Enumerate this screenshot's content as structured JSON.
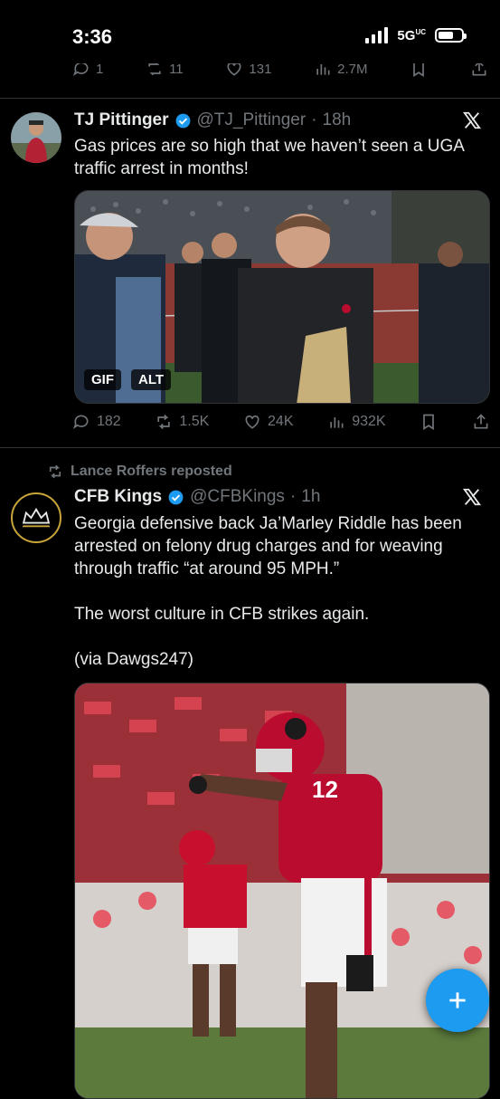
{
  "status_bar": {
    "time": "3:36",
    "network": "5G",
    "network_suffix": "UC"
  },
  "previous_tweet": {
    "replies": "1",
    "reposts": "11",
    "likes": "131",
    "views": "2.7M"
  },
  "tweet1": {
    "name": "TJ Pittinger",
    "handle": "@TJ_Pittinger",
    "separator": "·",
    "time": "18h",
    "text": "Gas prices are so high that we haven’t seen a UGA traffic arrest in months!",
    "media_badges": [
      "GIF",
      "ALT"
    ],
    "replies": "182",
    "reposts": "1.5K",
    "likes": "24K",
    "views": "932K"
  },
  "repost_context": {
    "label": "Lance Roffers reposted"
  },
  "tweet2": {
    "name": "CFB Kings",
    "handle": "@CFBKings",
    "separator": "·",
    "time": "1h",
    "text": "Georgia defensive back Ja’Marley Riddle has been arrested on felony drug charges and for weaving through traffic “at around 95 MPH.”\n\nThe worst culture in CFB strikes again.\n\n(via Dawgs247)",
    "jersey_number": "12"
  },
  "colors": {
    "accent": "#1d9bf0",
    "background": "#000000",
    "muted": "#71767b",
    "uga_red": "#ba0c2f"
  },
  "icons": [
    "reply-icon",
    "repost-icon",
    "like-icon",
    "views-icon",
    "bookmark-icon",
    "share-icon",
    "x-logo-icon",
    "verified-icon",
    "compose-icon"
  ]
}
